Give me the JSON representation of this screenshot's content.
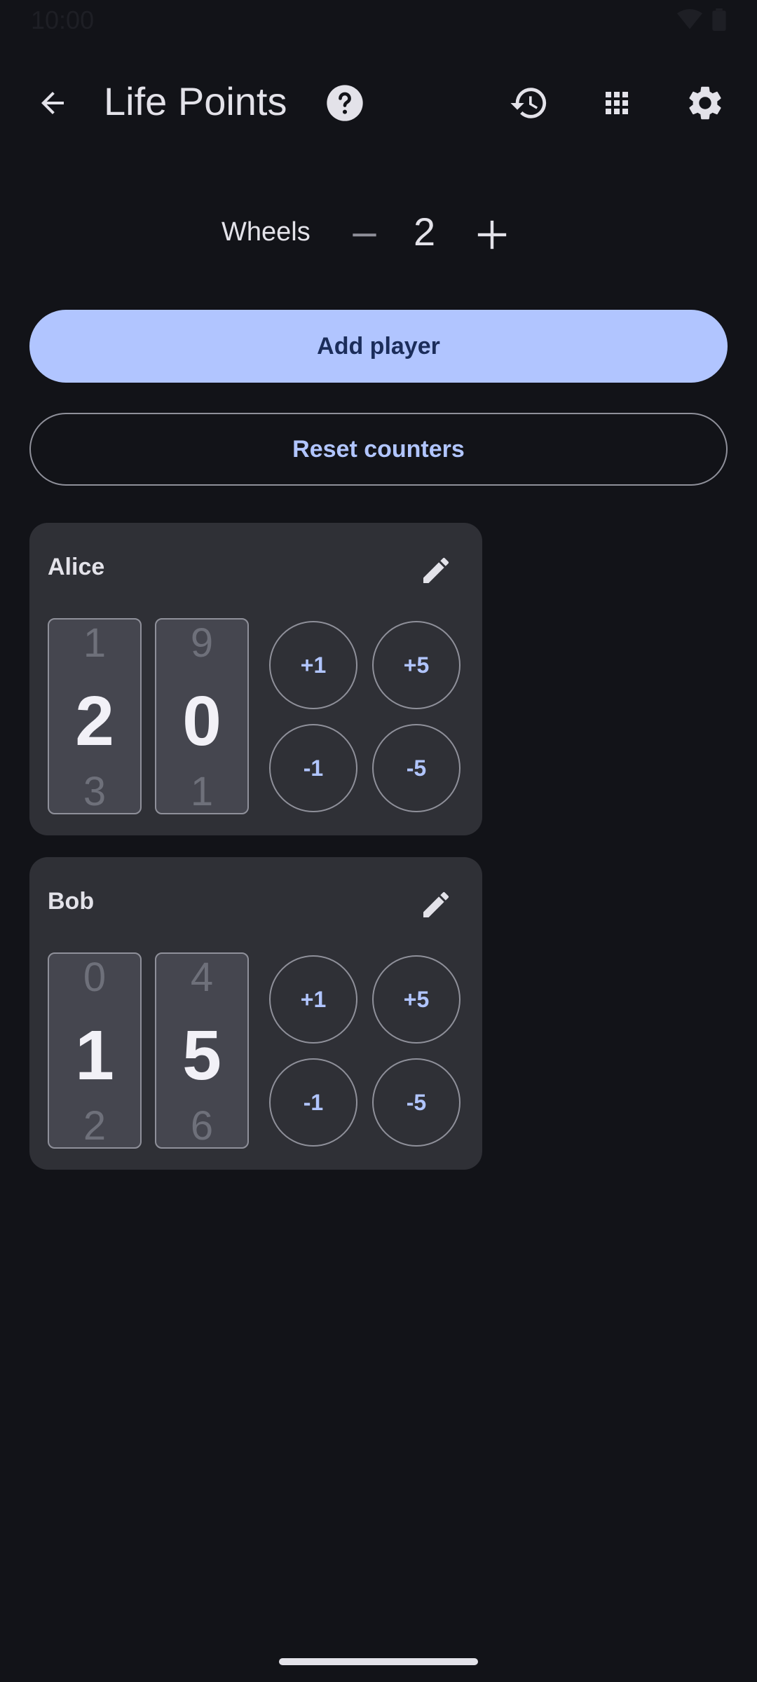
{
  "status_bar": {
    "time": "10:00"
  },
  "app_bar": {
    "title": "Life Points"
  },
  "wheels": {
    "label": "Wheels",
    "value": "2",
    "minus_label": "−",
    "plus_label": "+"
  },
  "actions": {
    "add_player": "Add player",
    "reset_counters": "Reset counters"
  },
  "players": [
    {
      "name": "Alice",
      "wheels": [
        {
          "above": "1",
          "current": "2",
          "below": "3"
        },
        {
          "above": "9",
          "current": "0",
          "below": "1"
        }
      ],
      "buttons": [
        "+1",
        "+5",
        "-1",
        "-5"
      ]
    },
    {
      "name": "Bob",
      "wheels": [
        {
          "above": "0",
          "current": "1",
          "below": "2"
        },
        {
          "above": "4",
          "current": "5",
          "below": "6"
        }
      ],
      "buttons": [
        "+1",
        "+5",
        "-1",
        "-5"
      ]
    }
  ],
  "colors": {
    "background": "#121318",
    "primary": "#b1c5ff",
    "on_primary": "#1b2d5a",
    "card": "#2f3036",
    "outline": "#8f909a"
  }
}
